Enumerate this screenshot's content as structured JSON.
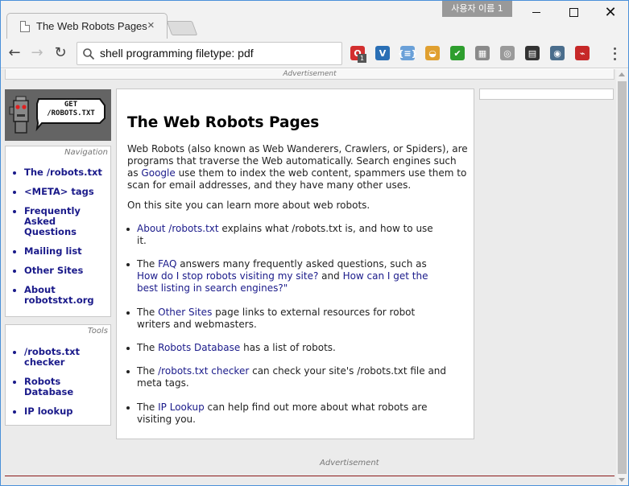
{
  "browser": {
    "tab": {
      "title": "The Web Robots Pages",
      "close": "×"
    },
    "profile_name": "사용자 이름 1",
    "window_controls": {
      "close": "✕"
    },
    "nav": {
      "back": "←",
      "forward": "→",
      "reload": "↻"
    },
    "omnibox": {
      "value": "shell programming filetype: pdf"
    },
    "extensions": [
      {
        "icon": "opera-icon",
        "color": "#d32f2f",
        "glyph": "O",
        "badge": "1"
      },
      {
        "icon": "vivaldi-v-icon",
        "color": "#2a6fb5",
        "glyph": "V"
      },
      {
        "icon": "json-braces-icon",
        "color": "#6aa0d8",
        "glyph": "{≡}"
      },
      {
        "icon": "chrome-cast-icon",
        "color": "#e0a030",
        "glyph": "◒"
      },
      {
        "icon": "green-check-icon",
        "color": "#2e9e2e",
        "glyph": "✔"
      },
      {
        "icon": "gray-grid-icon",
        "color": "#8a8a8a",
        "glyph": "▦"
      },
      {
        "icon": "compass-icon",
        "color": "#9a9a9a",
        "glyph": "◎"
      },
      {
        "icon": "clapper-icon",
        "color": "#333333",
        "glyph": "▤"
      },
      {
        "icon": "eye-shield-icon",
        "color": "#4a6d8c",
        "glyph": "◉"
      },
      {
        "icon": "acrobat-icon",
        "color": "#c62828",
        "glyph": "⌁"
      }
    ]
  },
  "page": {
    "ad_top": "Advertisement",
    "logo_text": [
      "GET",
      "/ROBOTS.TXT"
    ],
    "navigation": {
      "title": "Navigation",
      "items": [
        [
          "The /robots.txt"
        ],
        [
          "<META> tags"
        ],
        [
          "Frequently",
          "Asked",
          "Questions"
        ],
        [
          "Mailing list"
        ],
        [
          "Other Sites"
        ],
        [
          "About",
          "robotstxt.org"
        ]
      ]
    },
    "tools": {
      "title": "Tools",
      "items": [
        [
          "/robots.txt",
          "checker"
        ],
        [
          "Robots",
          "Database"
        ],
        [
          "IP lookup"
        ]
      ]
    },
    "main": {
      "title": "The Web Robots Pages",
      "intro": {
        "l1": "Web Robots (also known as Web Wanderers, Crawlers, or Spiders), are",
        "l2": "programs that traverse the Web automatically. Search engines such",
        "l3_pre": "as ",
        "l3_link": "Google",
        "l3_post": " use them to index the web content, spammers use them to",
        "l4": "scan for email addresses, and they have many other uses."
      },
      "learn_more": "On this site you can learn more about web robots.",
      "bullets": {
        "about": {
          "link": "About /robots.txt",
          "text1": " explains what /robots.txt is, and how to use",
          "text2": "it."
        },
        "faq": {
          "pre": "The ",
          "link": "FAQ",
          "post": " answers many frequently asked questions, such as",
          "q1": "How do I stop robots visiting my site?",
          "and": " and ",
          "q2a": "How can I get the",
          "q2b": "best listing in search engines?\""
        },
        "other": {
          "pre": "The ",
          "link": "Other Sites",
          "post": " page links to external resources for robot",
          "line2": "writers and webmasters."
        },
        "db": {
          "pre": "The ",
          "link": "Robots Database",
          "post": " has a list of robots."
        },
        "checker": {
          "pre": "The ",
          "link": "/robots.txt checker",
          "post": " can check your site's /robots.txt file and",
          "line2": "meta tags."
        },
        "ip": {
          "pre": "The ",
          "link": "IP Lookup",
          "post": " can help find out more about what robots are",
          "line2": "visiting you."
        }
      }
    },
    "ad_bottom": "Advertisement"
  }
}
